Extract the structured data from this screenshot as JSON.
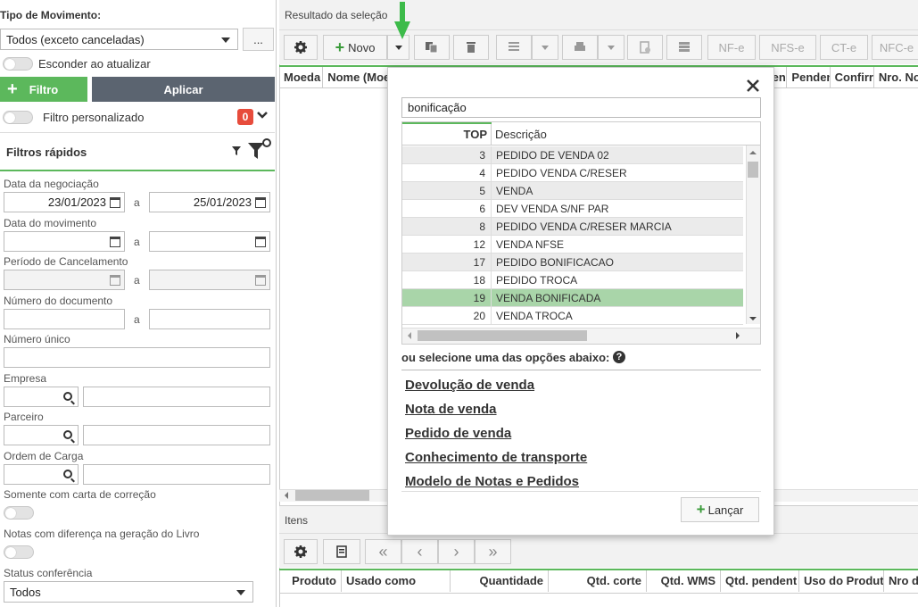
{
  "left": {
    "tipo_label": "Tipo de Movimento:",
    "tipo_value": "Todos (exceto canceladas)",
    "more_label": "...",
    "esconder_label": "Esconder ao atualizar",
    "filtro_label": "Filtro",
    "aplicar_label": "Aplicar",
    "filtro_pers_label": "Filtro personalizado",
    "filtro_pers_count": "0",
    "filtros_rapidos_label": "Filtros rápidos",
    "data_neg_label": "Data da negociação",
    "data_neg_from": "23/01/2023",
    "data_neg_to": "25/01/2023",
    "a": "a",
    "data_mov_label": "Data do movimento",
    "periodo_label": "Período de Cancelamento",
    "numdoc_label": "Número do documento",
    "numunico_label": "Número único",
    "empresa_label": "Empresa",
    "parceiro_label": "Parceiro",
    "ordem_label": "Ordem de Carga",
    "carta_label": "Somente com carta de correção",
    "notas_label": "Notas com diferença na geração do Livro",
    "status_label": "Status conferência",
    "status_value": "Todos"
  },
  "right": {
    "resultado_label": "Resultado da seleção",
    "novo_label": "Novo",
    "nfe": "NF-e",
    "nfse": "NFS-e",
    "cte": "CT-e",
    "nfce": "NFC-e",
    "cols": [
      "Moeda",
      "Nome (Moe",
      "Pendei",
      "Penden",
      "Confirr",
      "Nro. No"
    ],
    "itens_label": "Itens",
    "item_cols": [
      "Produto",
      "Usado como",
      "Quantidade",
      "Qtd. corte",
      "Qtd. WMS",
      "Qtd. pendent",
      "Uso do Produt",
      "Nro de"
    ]
  },
  "popup": {
    "search_value": "bonificação",
    "col_top": "TOP",
    "col_desc": "Descrição",
    "rows": [
      {
        "top": "3",
        "desc": "PEDIDO DE VENDA 02"
      },
      {
        "top": "4",
        "desc": "PEDIDO VENDA C/RESER"
      },
      {
        "top": "5",
        "desc": "VENDA"
      },
      {
        "top": "6",
        "desc": "DEV VENDA S/NF PAR"
      },
      {
        "top": "8",
        "desc": "PEDIDO VENDA C/RESER MARCIA"
      },
      {
        "top": "12",
        "desc": "VENDA NFSE"
      },
      {
        "top": "17",
        "desc": "PEDIDO BONIFICACAO"
      },
      {
        "top": "18",
        "desc": "PEDIDO TROCA"
      },
      {
        "top": "19",
        "desc": "VENDA BONIFICADA"
      },
      {
        "top": "20",
        "desc": "VENDA TROCA"
      }
    ],
    "selected_index": 8,
    "ou_label": "ou selecione uma das opções abaixo:",
    "options": [
      "Devolução de venda",
      "Nota de venda",
      "Pedido de venda",
      "Conhecimento de transporte",
      "Modelo de Notas e Pedidos"
    ],
    "lancar_label": "Lançar"
  },
  "colors": {
    "green": "#5cb85c",
    "selected": "#a9d5a9",
    "dark": "#5b6470",
    "badge": "#e74c3c",
    "arrow": "#3dbb4a"
  }
}
